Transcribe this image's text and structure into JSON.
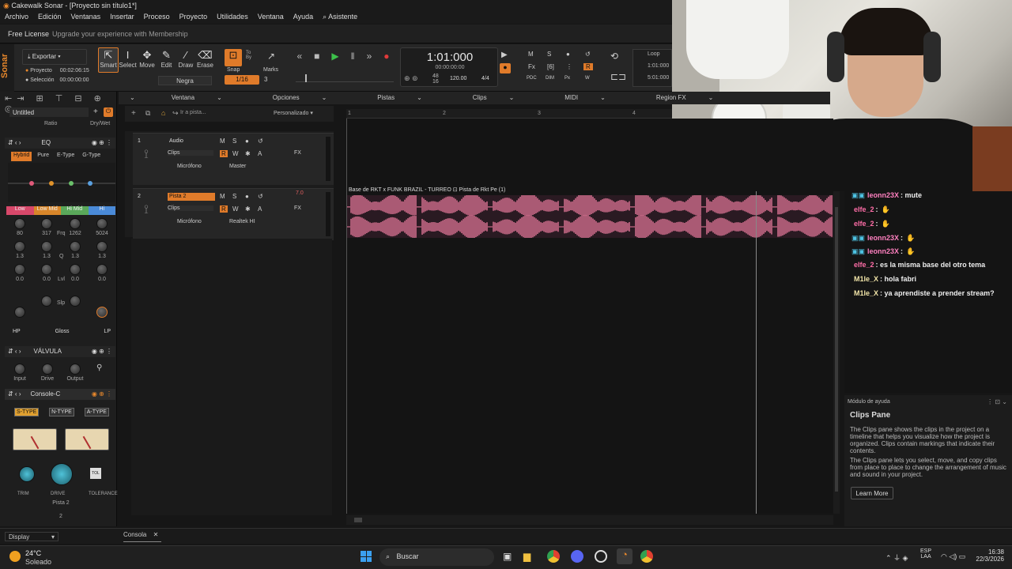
{
  "window": {
    "title": "Cakewalk Sonar - [Proyecto sin título1*]"
  },
  "menu": [
    "Archivo",
    "Edición",
    "Ventanas",
    "Insertar",
    "Proceso",
    "Proyecto",
    "Utilidades",
    "Ventana",
    "Ayuda",
    "⌕ Asistente"
  ],
  "license": {
    "label": "Free License",
    "upgrade": "Upgrade your experience with Membership"
  },
  "brand": "Sonar",
  "export": {
    "label": "Exportar",
    "project_label": "Proyecto",
    "project_time": "00:02:06:15",
    "selection_label": "Selección",
    "selection_time": "00:00:00:00"
  },
  "tools": [
    {
      "icon": "smart-cursor-icon",
      "label": "Smart"
    },
    {
      "icon": "select-icon",
      "label": "Select"
    },
    {
      "icon": "move-icon",
      "label": "Move"
    },
    {
      "icon": "edit-icon",
      "label": "Edit"
    },
    {
      "icon": "draw-icon",
      "label": "Draw"
    },
    {
      "icon": "erase-icon",
      "label": "Erase"
    }
  ],
  "tool_value": "Negra",
  "snap": {
    "label": "Snap",
    "value": "1/16",
    "count": "3",
    "to": "To",
    "by": "By",
    "marks": "Marks"
  },
  "transport": {
    "time": "1:01:000",
    "timecode": "00:00:00:00",
    "bpm": "120.00",
    "time_sig": "4/4",
    "beats_top": "48",
    "beats_bottom": "16"
  },
  "mix_buttons": [
    "M",
    "S",
    "●",
    "↺",
    "Fx",
    "[6]",
    "⋮",
    "R",
    "PDC",
    "DIM",
    "Px",
    "W"
  ],
  "loop": {
    "label": "Loop",
    "start": "1:01:000",
    "end": "5:01:000"
  },
  "inspector": {
    "preset": "Untitled",
    "ratio": "Ratio",
    "drywet": "Dry/Wet"
  },
  "eq": {
    "title": "EQ",
    "modes": [
      "Hybrid",
      "Pure",
      "E-Type",
      "G-Type"
    ],
    "bands": [
      "Low",
      "Low Mid",
      "Hi Mid",
      "Hi"
    ],
    "freq": [
      "80",
      "317",
      "1262",
      "5024"
    ],
    "freq_label": "Frq",
    "q": [
      "1.3",
      "1.3",
      "1.3",
      "1.3"
    ],
    "q_label": "Q",
    "lvl": [
      "0.0",
      "0.0",
      "0.0",
      "0.0"
    ],
    "lvl_label": "Lvl",
    "slp_label": "Slp",
    "filters": [
      "HP",
      "Gloss",
      "LP"
    ]
  },
  "valve": {
    "title": "VÁLVULA",
    "knobs": [
      "Input",
      "Drive",
      "Output"
    ]
  },
  "console": {
    "title": "Console-C",
    "types": [
      "S-TYPE",
      "N-TYPE",
      "A-TYPE"
    ],
    "knobs": [
      "TRIM",
      "DRIVE",
      "TOLERANCE"
    ],
    "tol": "TOL",
    "track": "Pista 2",
    "num": "2"
  },
  "track_toolbar": {
    "goto_placeholder": "Ir a pista...",
    "preset": "Personalizado"
  },
  "view_menu": [
    "Ventana",
    "Opciones",
    "Pistas",
    "Clips",
    "MIDI",
    "Region FX"
  ],
  "ruler": [
    "1",
    "2",
    "3",
    "4"
  ],
  "tracks": [
    {
      "num": "1",
      "name": "Audio",
      "clips": "Clips",
      "input": "Micrófono",
      "output": "Master",
      "fx": "FX",
      "vol": ""
    },
    {
      "num": "2",
      "name": "Pista 2",
      "clips": "Clips",
      "input": "Micrófono",
      "output": "Realtek HI",
      "fx": "FX",
      "vol": "7.0"
    }
  ],
  "clip": {
    "title": "Base de RKT x FUNK BRAZIL - TURREO ⊡  Pista de Rkt Pe (1)"
  },
  "chat": [
    {
      "user": "leonn23X",
      "msg": ": mute",
      "color": "#ff80c0"
    },
    {
      "user": "elfe_2",
      "msg": ":",
      "color": "#ff6ea8"
    },
    {
      "user": "elfe_2",
      "msg": ":",
      "color": "#ff6ea8"
    },
    {
      "user": "leonn23X",
      "msg": ":",
      "color": "#ff80c0"
    },
    {
      "user": "leonn23X",
      "msg": ":",
      "color": "#ff80c0"
    },
    {
      "user": "elfe_2",
      "msg": ": es la misma base del otro tema",
      "color": "#ff6ea8"
    },
    {
      "user": "M1le_X",
      "msg": ": hola fabri",
      "color": "#f1e4a8"
    },
    {
      "user": "M1le_X",
      "msg": ": ya aprendiste a prender stream?",
      "color": "#f1e4a8"
    }
  ],
  "help": {
    "module": "Módulo de ayuda",
    "title": "Clips Pane",
    "p1": "The Clips pane shows the clips in the project on a timeline that helps you visualize how the project is organized. Clips contain markings that indicate their contents.",
    "p2": "The Clips pane lets you select, move, and copy clips from place to place to change the arrangement of music and sound in your project.",
    "button": "Learn More"
  },
  "bottom": {
    "display": "Display",
    "console_tab": "Consola"
  },
  "taskbar": {
    "temp": "24°C",
    "weather": "Soleado",
    "search": "Buscar",
    "lang1": "ESP",
    "lang2": "LAA",
    "time": "16:38",
    "date": "22/3/2026"
  }
}
